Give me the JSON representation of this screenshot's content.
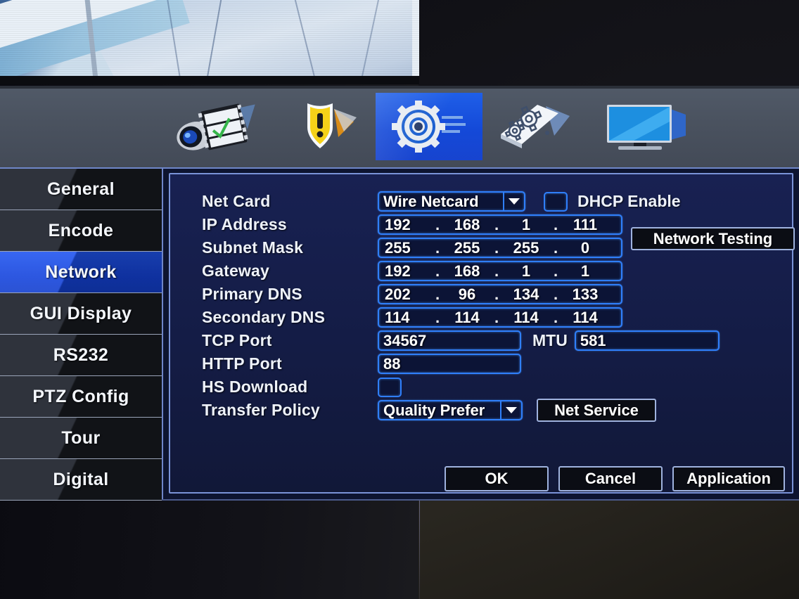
{
  "device": {
    "type": "dvr-nvr-setup-screen"
  },
  "toolbar": {
    "items": [
      {
        "name": "record-config-icon",
        "label": "Record"
      },
      {
        "name": "alarm-shield-icon",
        "label": "Alarm"
      },
      {
        "name": "system-gear-icon",
        "label": "System",
        "selected": true
      },
      {
        "name": "advanced-tools-icon",
        "label": "Advanced"
      },
      {
        "name": "display-monitor-icon",
        "label": "Info"
      }
    ]
  },
  "sidebar": {
    "items": [
      {
        "label": "General",
        "active": false
      },
      {
        "label": "Encode",
        "active": false
      },
      {
        "label": "Network",
        "active": true
      },
      {
        "label": "GUI Display",
        "active": false
      },
      {
        "label": "RS232",
        "active": false
      },
      {
        "label": "PTZ Config",
        "active": false
      },
      {
        "label": "Tour",
        "active": false
      },
      {
        "label": "Digital",
        "active": false
      }
    ]
  },
  "form": {
    "net_card": {
      "label": "Net Card",
      "value": "Wire Netcard"
    },
    "dhcp": {
      "label": "DHCP Enable",
      "checked": false
    },
    "ip_address": {
      "label": "IP Address",
      "octets": [
        "192",
        "168",
        "1",
        "111"
      ]
    },
    "subnet_mask": {
      "label": "Subnet Mask",
      "octets": [
        "255",
        "255",
        "255",
        "0"
      ]
    },
    "gateway": {
      "label": "Gateway",
      "octets": [
        "192",
        "168",
        "1",
        "1"
      ]
    },
    "primary_dns": {
      "label": "Primary DNS",
      "octets": [
        "202",
        "96",
        "134",
        "133"
      ]
    },
    "secondary_dns": {
      "label": "Secondary DNS",
      "octets": [
        "114",
        "114",
        "114",
        "114"
      ]
    },
    "tcp_port": {
      "label": "TCP Port",
      "value": "34567"
    },
    "mtu": {
      "label": "MTU",
      "value": "581"
    },
    "http_port": {
      "label": "HTTP Port",
      "value": "88"
    },
    "hs_download": {
      "label": "HS Download",
      "checked": false
    },
    "transfer_policy": {
      "label": "Transfer Policy",
      "value": "Quality Prefer"
    }
  },
  "buttons": {
    "network_testing": "Network Testing",
    "net_service": "Net Service",
    "ok": "OK",
    "cancel": "Cancel",
    "application": "Application"
  },
  "colors": {
    "accent_blue": "#1544dd",
    "field_border": "#2f7ffb",
    "panel_bg": "#141c45",
    "toolbar_bg": "#4a525f"
  }
}
